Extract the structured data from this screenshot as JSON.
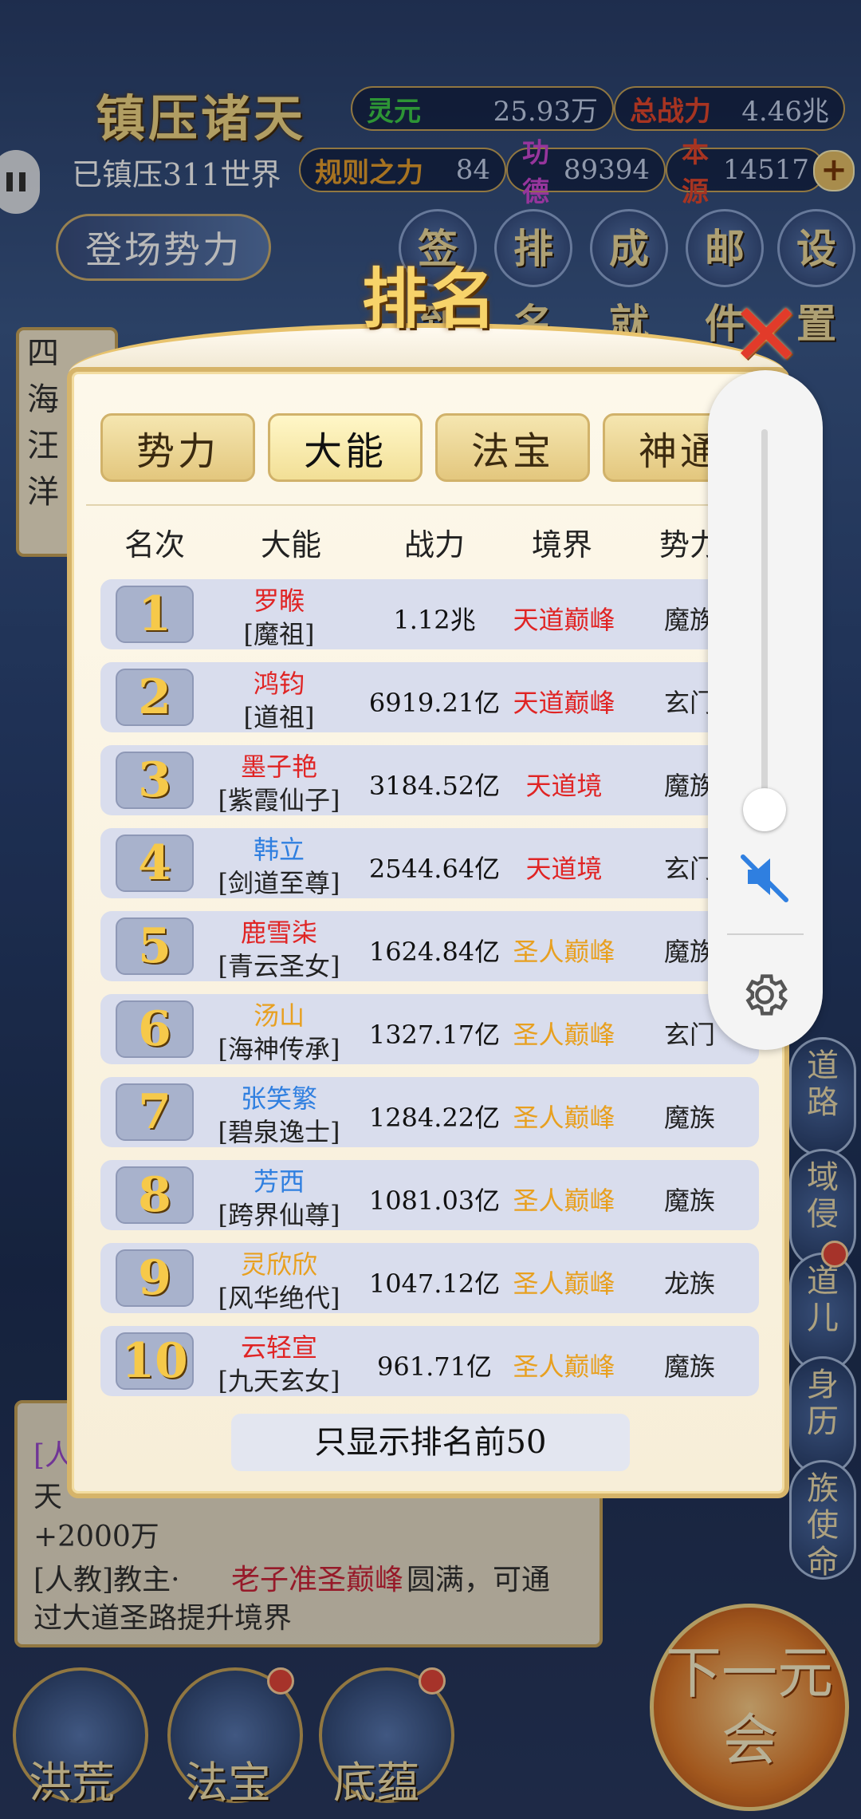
{
  "hud": {
    "title": "镇压诸天",
    "subtitle": "已镇压311世界",
    "stats": [
      {
        "label": "灵元",
        "value": "25.93万",
        "color": "#3fcf4a"
      },
      {
        "label": "总战力",
        "value": "4.46兆",
        "color": "#e8482e"
      },
      {
        "label": "规则之力",
        "value": "84",
        "color": "#e8a02e"
      },
      {
        "label": "功德",
        "value": "89394",
        "color": "#d04ad8"
      },
      {
        "label": "本源",
        "value": "14517",
        "color": "#e8482e"
      }
    ],
    "plus": "+",
    "deploy_label": "登场势力",
    "menu": [
      "签到",
      "排名",
      "成就",
      "邮件",
      "设置"
    ]
  },
  "background": {
    "left_panel_chars": [
      "四",
      "海",
      "汪",
      "洋"
    ],
    "log_lines": [
      "[人",
      "天",
      "+2000万",
      "[人教]教主·",
      "老子准圣巅峰",
      "圆满，可通",
      "过大道圣路提升境界"
    ],
    "right_buttons": [
      "道路",
      "域侵",
      "道儿",
      "身历",
      "族使命"
    ],
    "bottom_nav": [
      "洪荒",
      "法宝",
      "底蕴"
    ],
    "next_era": "下一元会"
  },
  "modal": {
    "title": "排名",
    "close": "✕",
    "tabs": [
      "势力",
      "大能",
      "法宝",
      "神通"
    ],
    "active_tab": 1,
    "headers": [
      "名次",
      "大能",
      "战力",
      "境界",
      "势力"
    ],
    "rows": [
      {
        "rank": "1",
        "name": "罗睺",
        "name_color": "#e02424",
        "title": "[魔祖]",
        "power": "1.12兆",
        "realm": "天道巅峰",
        "realm_color": "#e02424",
        "faction": "魔族"
      },
      {
        "rank": "2",
        "name": "鸿钧",
        "name_color": "#e02424",
        "title": "[道祖]",
        "power": "6919.21亿",
        "realm": "天道巅峰",
        "realm_color": "#e02424",
        "faction": "玄门"
      },
      {
        "rank": "3",
        "name": "墨子艳",
        "name_color": "#e02424",
        "title": "[紫霞仙子]",
        "power": "3184.52亿",
        "realm": "天道境",
        "realm_color": "#e02424",
        "faction": "魔族"
      },
      {
        "rank": "4",
        "name": "韩立",
        "name_color": "#2f7fe0",
        "title": "[剑道至尊]",
        "power": "2544.64亿",
        "realm": "天道境",
        "realm_color": "#e02424",
        "faction": "玄门"
      },
      {
        "rank": "5",
        "name": "鹿雪柒",
        "name_color": "#e02424",
        "title": "[青云圣女]",
        "power": "1624.84亿",
        "realm": "圣人巅峰",
        "realm_color": "#e8a020",
        "faction": "魔族"
      },
      {
        "rank": "6",
        "name": "汤山",
        "name_color": "#e8a020",
        "title": "[海神传承]",
        "power": "1327.17亿",
        "realm": "圣人巅峰",
        "realm_color": "#e8a020",
        "faction": "玄门"
      },
      {
        "rank": "7",
        "name": "张笑繁",
        "name_color": "#2f7fe0",
        "title": "[碧泉逸士]",
        "power": "1284.22亿",
        "realm": "圣人巅峰",
        "realm_color": "#e8a020",
        "faction": "魔族"
      },
      {
        "rank": "8",
        "name": "芳西",
        "name_color": "#2f7fe0",
        "title": "[跨界仙尊]",
        "power": "1081.03亿",
        "realm": "圣人巅峰",
        "realm_color": "#e8a020",
        "faction": "魔族"
      },
      {
        "rank": "9",
        "name": "灵欣欣",
        "name_color": "#e8a020",
        "title": "[风华绝代]",
        "power": "1047.12亿",
        "realm": "圣人巅峰",
        "realm_color": "#e8a020",
        "faction": "龙族"
      },
      {
        "rank": "10",
        "name": "云轻宣",
        "name_color": "#e02424",
        "title": "[九天玄女]",
        "power": "961.71亿",
        "realm": "圣人巅峰",
        "realm_color": "#e8a020",
        "faction": "魔族"
      }
    ],
    "footer_note": "只显示排名前50"
  },
  "volume": {
    "level": 0.06,
    "muted": true,
    "mute_icon": "volume-muted-icon",
    "settings_icon": "gear-icon"
  }
}
